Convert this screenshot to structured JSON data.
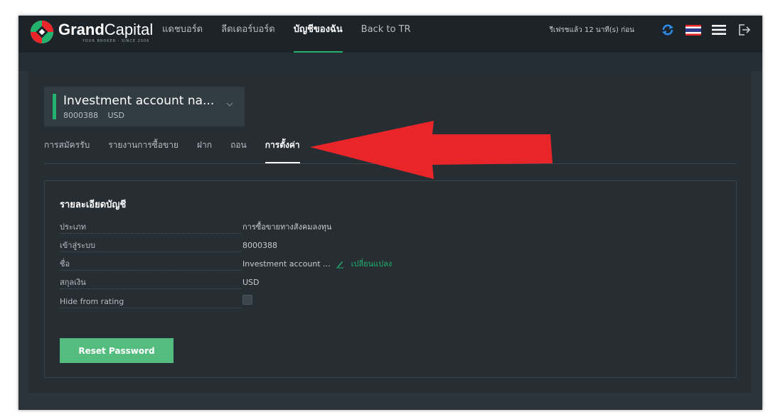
{
  "header": {
    "logo": {
      "name_bold": "Grand",
      "name_regular": "Capital",
      "tagline": "YOUR BROKER · SINCE 2006"
    },
    "nav": [
      {
        "label": "แดชบอร์ด",
        "active": false
      },
      {
        "label": "ลีดเดอร์บอร์ด",
        "active": false
      },
      {
        "label": "บัญชีของฉัน",
        "active": true
      },
      {
        "label": "Back to TR",
        "active": false
      }
    ],
    "refresh_text": "รีเฟรชแล้ว 12 นาที(s) ก่อน",
    "icons": [
      "refresh-icon",
      "thai-flag-icon",
      "menu-icon",
      "logout-icon"
    ]
  },
  "account": {
    "name": "Investment account na...",
    "number": "8000388",
    "currency": "USD"
  },
  "tabs": [
    {
      "label": "การสมัครรับ",
      "active": false
    },
    {
      "label": "รายงานการซื้อขาย",
      "active": false
    },
    {
      "label": "ฝาก",
      "active": false
    },
    {
      "label": "ถอน",
      "active": false
    },
    {
      "label": "การตั้งค่า",
      "active": true
    }
  ],
  "details": {
    "title": "รายละเอียดบัญชี",
    "rows": [
      {
        "label": "ประเภท",
        "value": "การซื้อขายทางสังคมลงทุน"
      },
      {
        "label": "เข้าสู่ระบบ",
        "value": "8000388"
      },
      {
        "label": "ชื่อ",
        "value": "Investment account ...",
        "link": "เปลี่ยนแปลง"
      },
      {
        "label": "สกุลเงิน",
        "value": "USD"
      },
      {
        "label": "Hide from rating",
        "checked": false
      }
    ],
    "reset_label": "Reset Password"
  },
  "colors": {
    "accent": "#23b26d",
    "button": "#54bc7e",
    "topbar": "#1d2429",
    "panel": "#262e34",
    "annotation_arrow": "#e8262a"
  }
}
